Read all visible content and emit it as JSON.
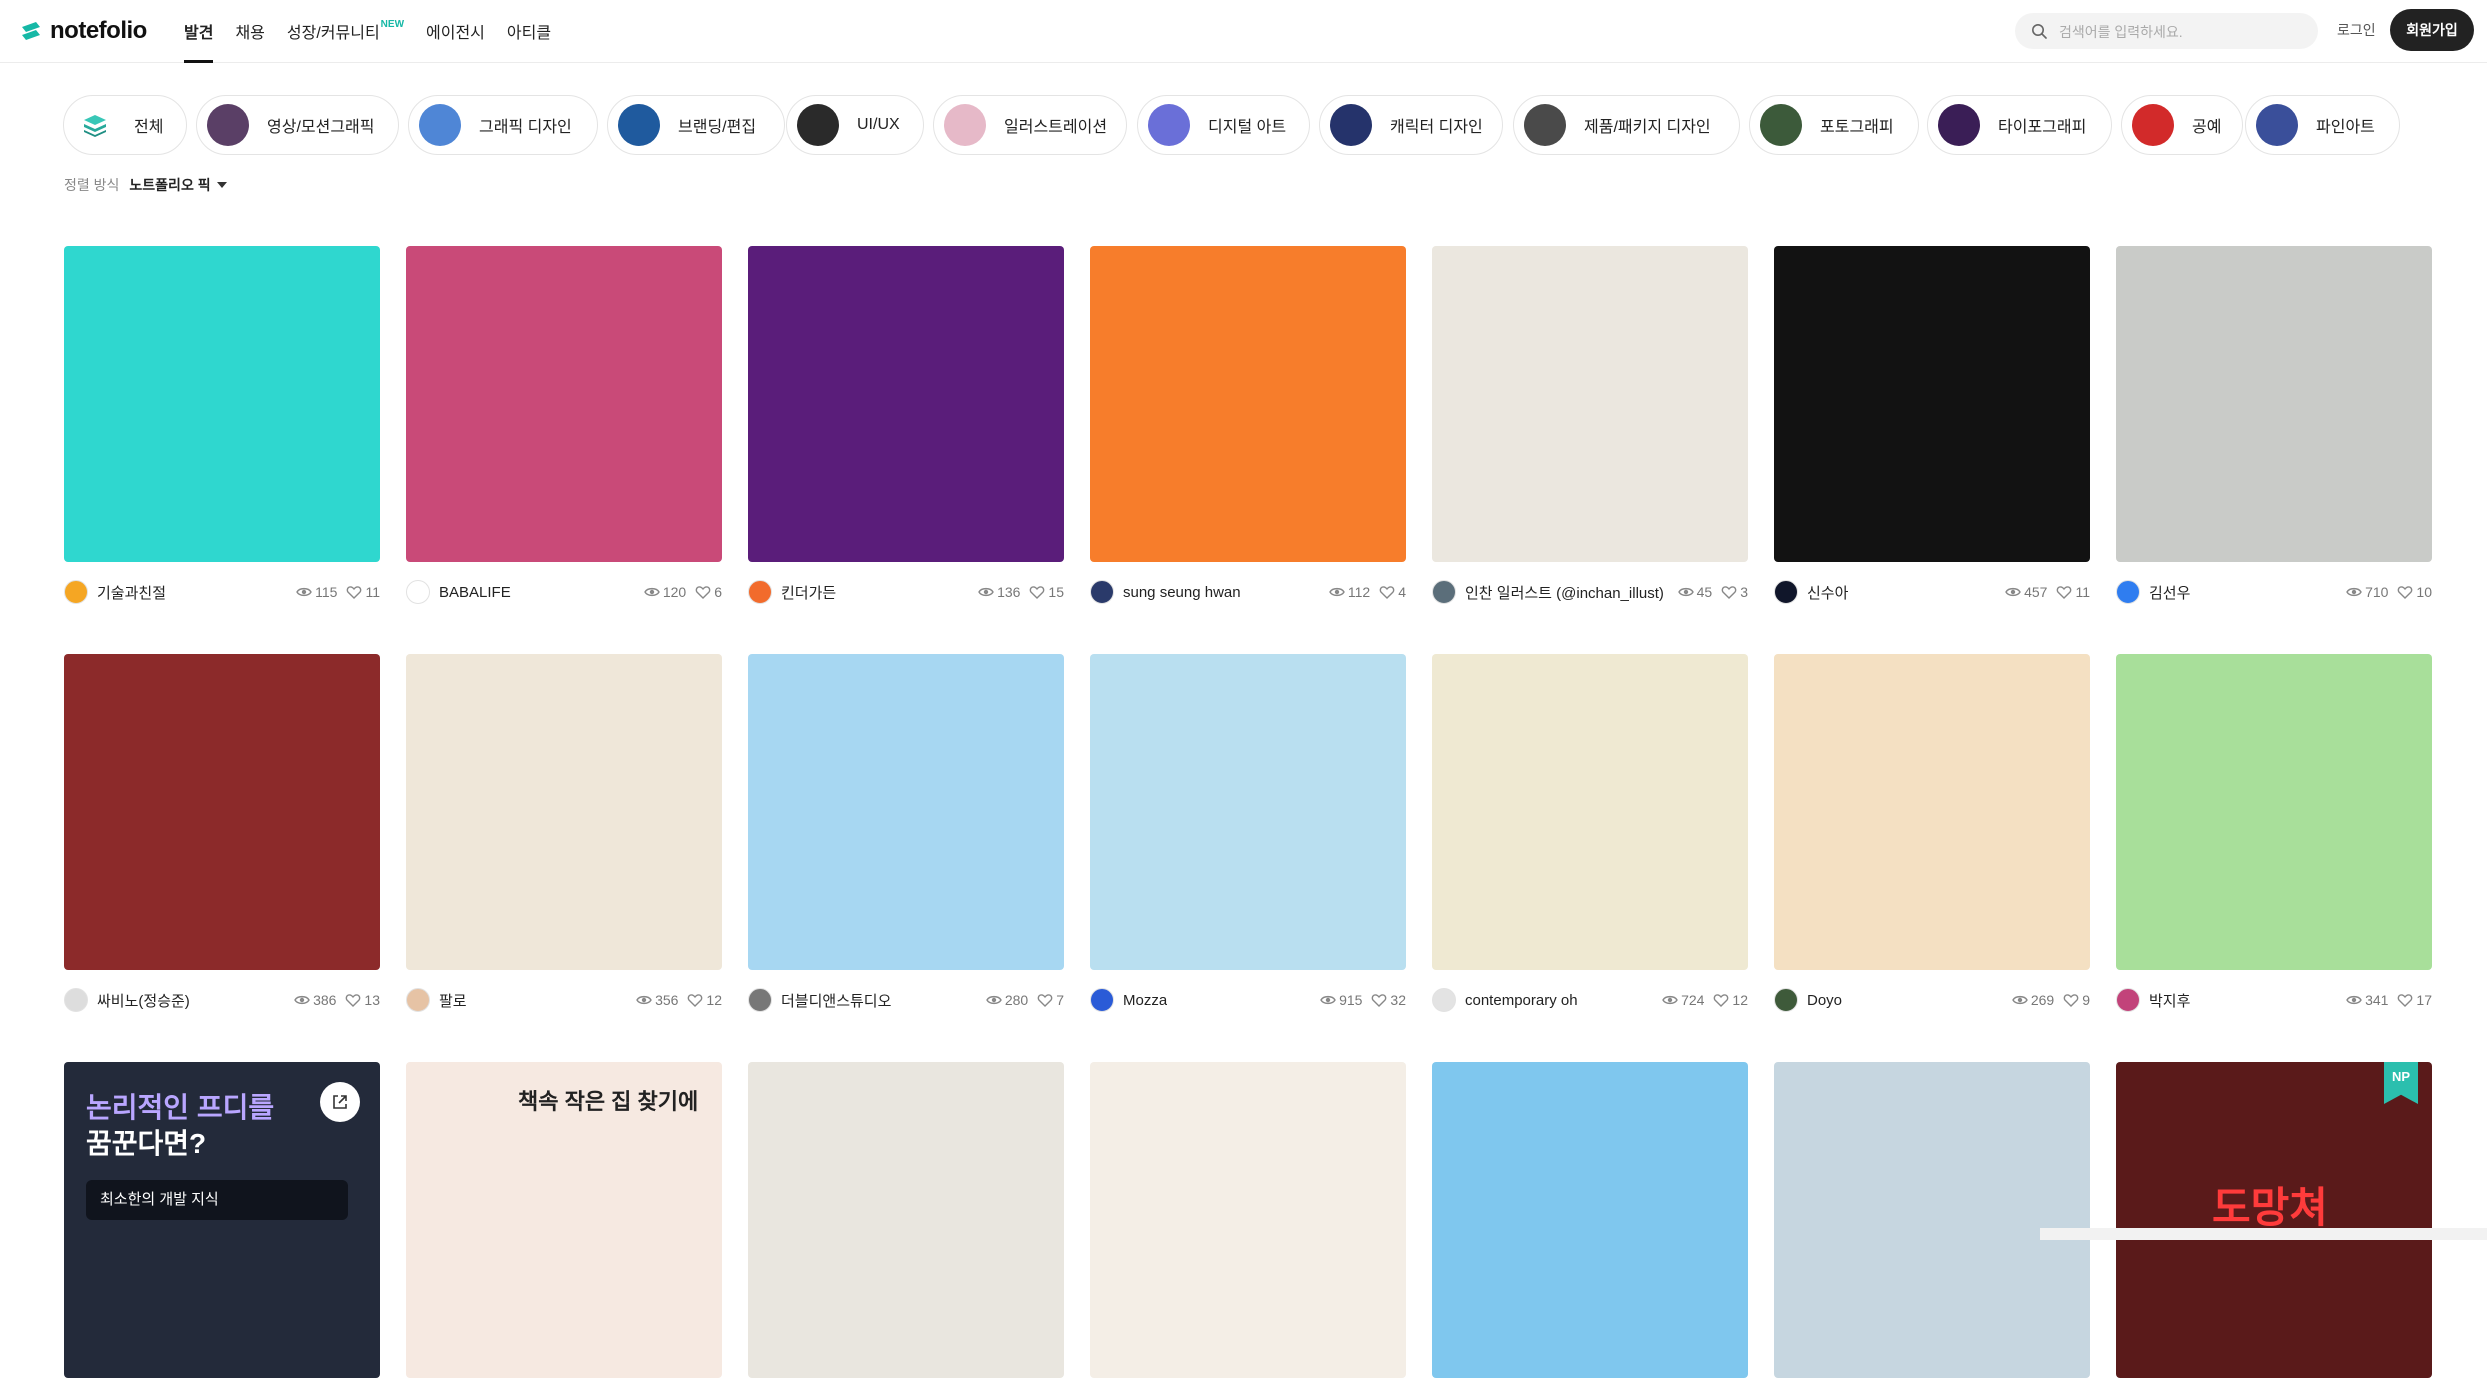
{
  "brand": {
    "name": "notefolio",
    "accent": "#16b8a6"
  },
  "nav": [
    {
      "label": "발견",
      "active": true
    },
    {
      "label": "채용"
    },
    {
      "label": "성장/커뮤니티",
      "badge": "NEW"
    },
    {
      "label": "에이전시"
    },
    {
      "label": "아티클"
    }
  ],
  "search": {
    "placeholder": "검색어를 입력하세요."
  },
  "auth": {
    "login": "로그인",
    "signup": "회원가입"
  },
  "categories": [
    {
      "label": "전체",
      "icon": "stack-icon"
    },
    {
      "label": "영상/모션그래픽",
      "color": "#5a3f66"
    },
    {
      "label": "그래픽 디자인",
      "color": "#4f86d6"
    },
    {
      "label": "브랜딩/편집",
      "color": "#1f5a9e"
    },
    {
      "label": "UI/UX",
      "color": "#2a2a2a"
    },
    {
      "label": "일러스트레이션",
      "color": "#e6b9c8"
    },
    {
      "label": "디지털 아트",
      "color": "#6a6fd8"
    },
    {
      "label": "캐릭터 디자인",
      "color": "#25336b"
    },
    {
      "label": "제품/패키지 디자인",
      "color": "#4a4a4a"
    },
    {
      "label": "포토그래피",
      "color": "#3c5a3a"
    },
    {
      "label": "타이포그래피",
      "color": "#3a1e56"
    },
    {
      "label": "공예",
      "color": "#d22a2a"
    },
    {
      "label": "파인아트",
      "color": "#3a4f9a"
    }
  ],
  "sort": {
    "label": "정렬 방식",
    "value": "노트폴리오 픽"
  },
  "cards": [
    {
      "author": "기술과친절",
      "views": "115",
      "likes": "11",
      "bg": "#2fd7cf",
      "avatar": "#f5a623"
    },
    {
      "author": "BABALIFE",
      "views": "120",
      "likes": "6",
      "bg": "#c94a78",
      "avatar": "#ffffff"
    },
    {
      "author": "킨더가든",
      "views": "136",
      "likes": "15",
      "bg": "#5a1d7a",
      "avatar": "#f26b2c"
    },
    {
      "author": "sung seung hwan",
      "views": "112",
      "likes": "4",
      "bg": "#f77d2b",
      "avatar": "#2a3a6a"
    },
    {
      "author": "인찬 일러스트 (@inchan_illust)",
      "views": "45",
      "likes": "3",
      "bg": "#ebe7df",
      "avatar": "#5b6e7a"
    },
    {
      "author": "신수아",
      "views": "457",
      "likes": "11",
      "bg": "#121212",
      "avatar": "#10162a"
    },
    {
      "author": "김선우",
      "views": "710",
      "likes": "10",
      "bg": "#c9cbc8",
      "avatar": "#2f7df0"
    },
    {
      "author": "싸비노(정승준)",
      "views": "386",
      "likes": "13",
      "bg": "#8c2a2a",
      "avatar": "#dddddd"
    },
    {
      "author": "팔로",
      "views": "356",
      "likes": "12",
      "bg": "#efe7d9",
      "avatar": "#e6c3a5"
    },
    {
      "author": "더블디앤스튜디오",
      "views": "280",
      "likes": "7",
      "bg": "#a7d7f2",
      "avatar": "#777777"
    },
    {
      "author": "Mozza",
      "views": "915",
      "likes": "32",
      "bg": "#b9dff0",
      "avatar": "#2a5bd7"
    },
    {
      "author": "contemporary oh",
      "views": "724",
      "likes": "12",
      "bg": "#efe9d2",
      "avatar": "#e3e3e3"
    },
    {
      "author": "Doyo",
      "views": "269",
      "likes": "9",
      "bg": "#f4e0c2",
      "avatar": "#3e5a3a"
    },
    {
      "author": "박지후",
      "views": "341",
      "likes": "17",
      "bg": "#a8df9a",
      "avatar": "#c2437a"
    },
    {
      "bg": "#232a3a",
      "overlay": {
        "title_line1": "논리적인 프디를",
        "title_line2": "꿈꾼다면?",
        "chip": "최소한의 개발 지식"
      }
    },
    {
      "bg": "#f6e9e1",
      "overlay": {
        "title": "책속 작은 집 찾기에"
      }
    },
    {
      "bg": "#e9e6df"
    },
    {
      "bg": "#f4eee6"
    },
    {
      "bg": "#7fc7ee"
    },
    {
      "bg": "#c6d6e0"
    },
    {
      "bg": "#5a1a1a",
      "overlay": {
        "badge": "NP",
        "text": "도망쳐"
      }
    }
  ]
}
